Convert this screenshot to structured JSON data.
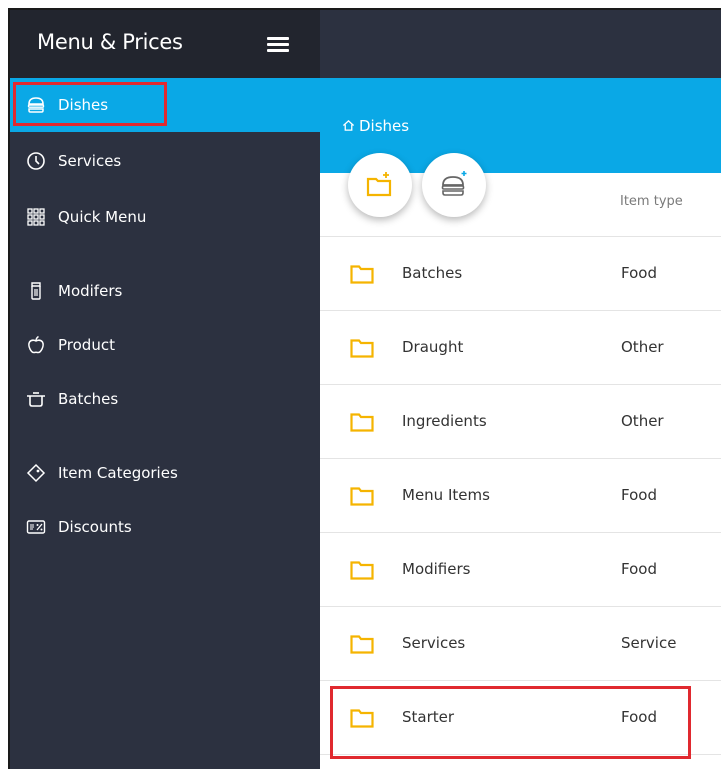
{
  "sidebar": {
    "title": "Menu & Prices",
    "items": [
      {
        "label": "Dishes",
        "icon": "burger-icon",
        "active": true
      },
      {
        "label": "Services",
        "icon": "clock-icon"
      },
      {
        "label": "Quick Menu",
        "icon": "grid-icon"
      },
      {
        "label": "Modifers",
        "icon": "shaker-icon"
      },
      {
        "label": "Product",
        "icon": "apple-icon"
      },
      {
        "label": "Batches",
        "icon": "pot-icon"
      },
      {
        "label": "Item Categories",
        "icon": "tag-icon"
      },
      {
        "label": "Discounts",
        "icon": "discount-icon"
      }
    ]
  },
  "main": {
    "breadcrumb": "Dishes",
    "column_header": "Item type",
    "rows": [
      {
        "name": "Batches",
        "type": "Food"
      },
      {
        "name": "Draught",
        "type": "Other"
      },
      {
        "name": "Ingredients",
        "type": "Other"
      },
      {
        "name": "Menu Items",
        "type": "Food"
      },
      {
        "name": "Modifiers",
        "type": "Food"
      },
      {
        "name": "Services",
        "type": "Service"
      },
      {
        "name": "Starter",
        "type": "Food"
      }
    ]
  },
  "colors": {
    "accent": "#0aa8e6",
    "sidebar_bg": "#2c3140",
    "header_bg": "#22252e",
    "folder": "#f5b400",
    "highlight": "#e0292f"
  }
}
